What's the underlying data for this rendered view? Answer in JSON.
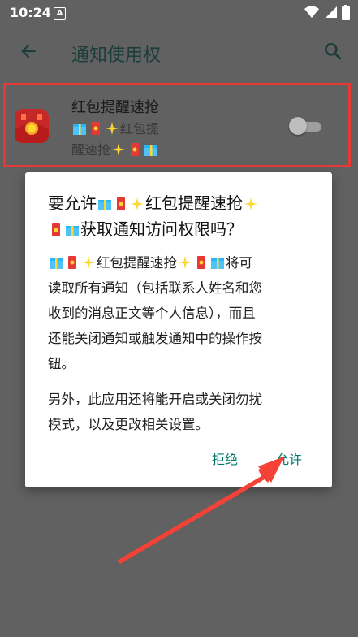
{
  "status_bar": {
    "time": "10:24",
    "badge": "A"
  },
  "app_bar": {
    "title": "通知使用权"
  },
  "app_row": {
    "name": "红包提醒速抢",
    "sub_line1_text": "红包提",
    "sub_line2_text": "醒速抢",
    "toggle_on": false
  },
  "dialog": {
    "title_prefix": "要允许",
    "title_app": "红包提醒速抢",
    "title_suffix": "获取通知访问权限吗？",
    "body_app": "红包提醒速抢",
    "body_text_1": "将可",
    "body_text_2": "读取所有通知（包括联系人姓名和您",
    "body_text_3": "收到的消息正文等个人信息），而且",
    "body_text_4": "还能关闭通知或触发通知中的操作按",
    "body_text_5": "钮。",
    "extra_text_1": "另外，此应用还将能开启或关闭勿扰",
    "extra_text_2": "模式，以及更改相关设置。",
    "deny_label": "拒绝",
    "allow_label": "允许"
  },
  "colors": {
    "accent": "#00796b",
    "highlight": "#e53935",
    "scrim": "#616161",
    "arrow": "#f44336"
  }
}
